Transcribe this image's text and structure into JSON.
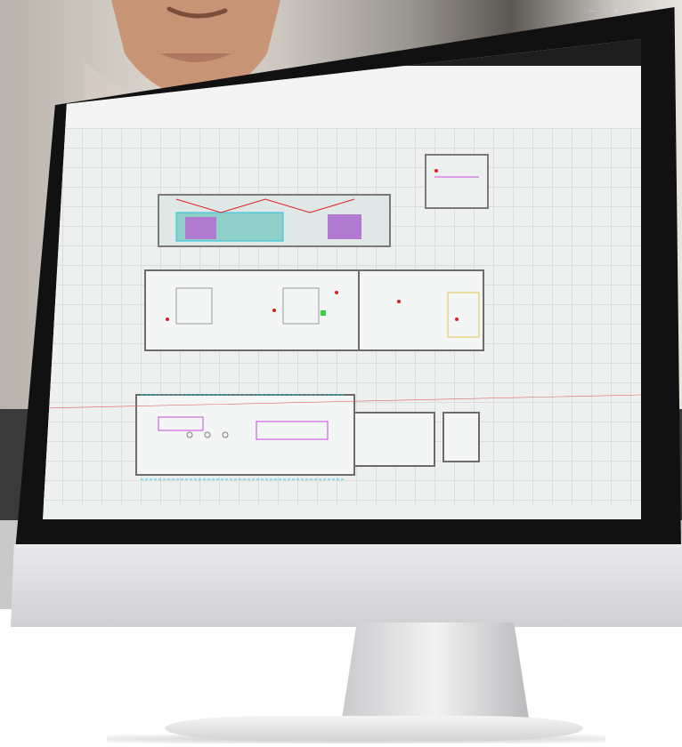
{
  "app": {
    "window_title": "",
    "ribbon_tabs": [],
    "ribbon_groups": [],
    "side_panel_label": "",
    "model_tab": "",
    "status_text": "",
    "window_controls": "— □ ✕"
  },
  "drawing": {
    "captions": []
  },
  "colors": {
    "cad_yellow": "#e3c64a",
    "cad_red": "#e02020",
    "cad_cyan": "#27c3e0",
    "cad_magenta": "#c44bd6",
    "cad_green": "#30d050",
    "cad_grey_wall": "#7a7a7a"
  },
  "icons": [
    "search-icon",
    "gear-icon",
    "layers-icon",
    "grid-icon"
  ]
}
